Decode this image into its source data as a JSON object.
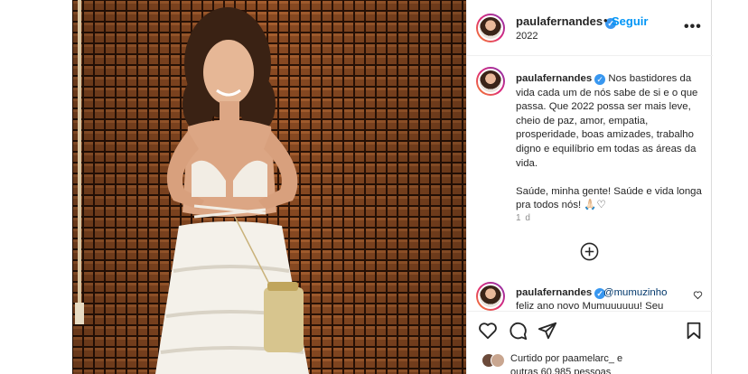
{
  "post": {
    "username": "paulafernandes",
    "follow_label": "Seguir",
    "separator": "•",
    "location": "2022",
    "more_label": "•••",
    "verified_mark": "✓"
  },
  "caption": {
    "username": "paulafernandes",
    "text": "Nos bastidores da vida cada um de nós sabe de si e o que passa. Que 2022 possa ser mais leve, cheio de paz, amor, empatia, prosperidade, boas amizades, trabalho digno e equilíbrio em todas as áreas da vida.\n\nSaúde, minha gente! Saúde e vida longa pra todos nós! 🙏🏻♡",
    "time": "1 d"
  },
  "comment": {
    "username": "paulafernandes",
    "mention": "@mumuzinho",
    "text": "feliz ano novo Mumuuuuuu! Seu"
  },
  "likes": {
    "prefix": "Curtido por",
    "user": "paamelarc_",
    "conjunction": "e",
    "count_text": "outras 60.985 pessoas"
  },
  "icons": {
    "next": "chevron-right-icon",
    "more": "more-options-icon",
    "add_comment": "plus-circle-icon",
    "like": "heart-icon",
    "comment": "comment-icon",
    "share": "share-icon",
    "save": "bookmark-icon"
  },
  "colors": {
    "link": "#0095f6",
    "verified": "#3897f0",
    "text": "#262626",
    "muted": "#8e8e8e",
    "mention": "#00376b"
  }
}
